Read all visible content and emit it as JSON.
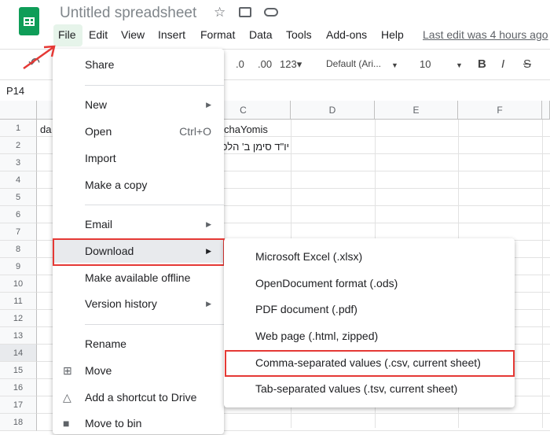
{
  "app": {
    "title": "Untitled spreadsheet",
    "last_edit": "Last edit was 4 hours ago",
    "brand_color": "#0f9d58"
  },
  "menubar": [
    "File",
    "Edit",
    "View",
    "Insert",
    "Format",
    "Data",
    "Tools",
    "Add-ons",
    "Help"
  ],
  "toolbar": {
    "decimal_decrease": ".0",
    "decimal_increase": ".00",
    "number_format": "123▾",
    "font": "Default (Ari...",
    "font_size": "10",
    "bold": "B",
    "italic": "I",
    "strike": "S"
  },
  "name_box": "P14",
  "columns": [
    "C",
    "D",
    "E",
    "F"
  ],
  "rows": [
    "1",
    "2",
    "3",
    "4",
    "5",
    "6",
    "7",
    "8",
    "9",
    "10",
    "11",
    "12",
    "13",
    "14",
    "15",
    "16",
    "17",
    "18"
  ],
  "cells": {
    "a1": "da",
    "c1": "chaYomis",
    "c2": "יו\"ד סימן ב' הלכ"
  },
  "file_menu": {
    "share": "Share",
    "new": "New",
    "open": "Open",
    "open_shortcut": "Ctrl+O",
    "import": "Import",
    "make_copy": "Make a copy",
    "email": "Email",
    "download": "Download",
    "offline": "Make available offline",
    "version_history": "Version history",
    "rename": "Rename",
    "move": "Move",
    "shortcut": "Add a shortcut to Drive",
    "bin": "Move to bin"
  },
  "download_menu": [
    "Microsoft Excel (.xlsx)",
    "OpenDocument format (.ods)",
    "PDF document (.pdf)",
    "Web page (.html, zipped)",
    "Comma-separated values (.csv, current sheet)",
    "Tab-separated values (.tsv, current sheet)"
  ],
  "highlight_color": "#e53935"
}
